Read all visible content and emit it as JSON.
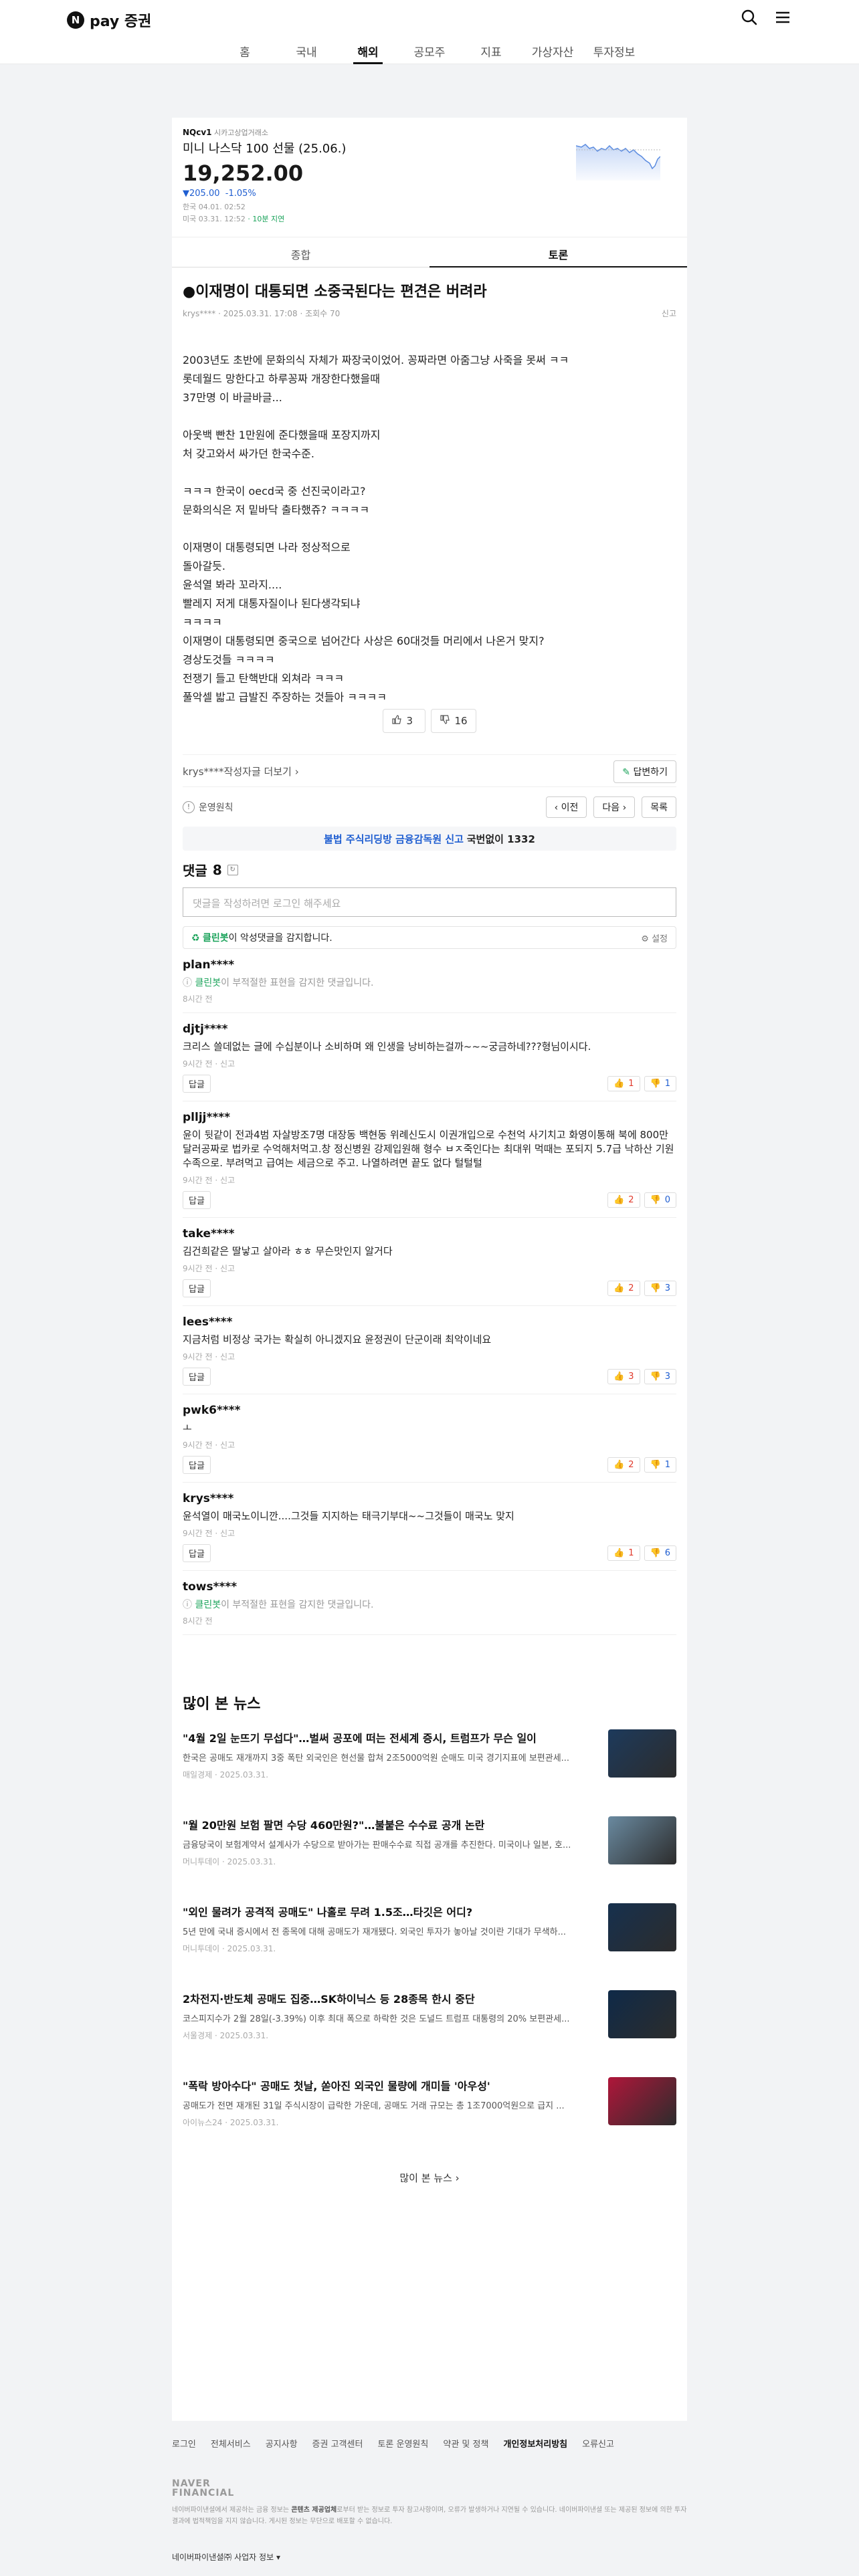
{
  "header": {
    "logo_n": "N",
    "logo_text": "pay 증권",
    "nav": [
      "홈",
      "국내",
      "해외",
      "공모주",
      "지표",
      "가상자산",
      "투자정보"
    ],
    "active_nav": "해외"
  },
  "stock": {
    "tag": "NQcv1",
    "exchange": "시카고상업거래소",
    "name": "미니 나스닥 100 선물 (25.06.)",
    "price": "19,252.00",
    "change": "▼205.00",
    "change_pct": "-1.05%",
    "kr_time": "한국 04.01. 02:52",
    "local_time": "미국 03.31. 12:52",
    "delay": "· 10분 지연",
    "down_color": "#1f5ed1"
  },
  "tabs": [
    "종합",
    "토론"
  ],
  "active_tab": "토론",
  "post": {
    "title": "●이재명이 대통되면 소중국된다는 편견은 버려라",
    "author": "krys****",
    "date": "2025.03.31. 17:08",
    "views": "조회수 70",
    "report": "신고",
    "body": [
      "2003년도 초반에 문화의식 자체가 짜장국이었어. 꽁짜라면 아줌그냥 사죽을 못써 ㅋㅋ",
      "롯데월드 망한다고 하루꽁짜 개장한다했을때",
      "37만명 이 바글바글...",
      "",
      "아웃백 빤찬 1만원에 준다했을때 포장지까지",
      "처 갖고와서 싸가던 한국수준.",
      "",
      "ㅋㅋㅋ 한국이 oecd국 중 선진국이라고?",
      "문화의식은 저 밑바닥 출타했쥬? ㅋㅋㅋㅋ",
      "",
      "이재명이 대통령되면 나라 정상적으로",
      "돌아갈듯.",
      "윤석열 봐라 꼬라지....",
      "빨레지 저게 대통자질이나 된다생각되냐",
      "ㅋㅋㅋㅋ",
      "이재명이 대통령되면 중국으로 넘어간다 사상은 60대것들 머리에서 나온거 맞지?",
      "경상도것들 ㅋㅋㅋㅋ",
      "전쟁기 들고 탄핵반대 외쳐라 ㅋㅋㅋ",
      "풀악셀 밟고 급발진 주장하는 것들아 ㅋㅋㅋㅋ"
    ],
    "likes": "3",
    "dislikes": "16",
    "more_by_author": "krys****작성자글 더보기",
    "reply_btn": "답변하기",
    "policy": "운영원칙",
    "prev": "이전",
    "next": "다음",
    "list": "목록",
    "banner_pre": "불법 주식리딩방 금융감독원 신고",
    "banner_post": "국번없이 1332"
  },
  "comments": {
    "label": "댓글",
    "count": "8",
    "placeholder": "댓글을 작성하려면 로그인 해주세요",
    "cleanbot_name": "클린봇",
    "cleanbot_text": "이 악성댓글을 감지합니다.",
    "setting": "설정",
    "reply_label": "답글",
    "report_label": "신고",
    "filtered_text": "이 부적절한 표현을 감지한 댓글입니다.",
    "items": [
      {
        "user": "plan****",
        "text": "",
        "time": "8시간 전",
        "up": "",
        "down": "",
        "filtered": true
      },
      {
        "user": "djtj****",
        "text": "크리스 쓸데없는 글에 수십분이나 소비하며 왜 인생을 낭비하는걸까~~~궁금하네???형님이시다.",
        "time": "9시간 전",
        "up": "1",
        "down": "1",
        "filtered": false
      },
      {
        "user": "plljj****",
        "text": "윤이 뒷같이 전과4범 자살방조7명 대장동 백현동 위례신도시 이권개입으로 수천억 사기치고 화영이통해 북에 800만달러공짜로 법카로 수억해처먹고.창 정신병원 강제입원해 형수 ㅂㅈ죽인다는 최대위 먹때는 포되지 5.7급 낙하산 기원 수족으로. 부려먹고 급여는 세금으로 주고. 나열하려면 끝도 없다 털털털",
        "time": "9시간 전",
        "up": "2",
        "down": "0",
        "filtered": false
      },
      {
        "user": "take****",
        "text": "김건희같은 딸낳고 살아라 ㅎㅎ 무슨맛인지 알거다",
        "time": "9시간 전",
        "up": "2",
        "down": "3",
        "filtered": false
      },
      {
        "user": "lees****",
        "text": "지금처럼 비정상 국가는 확실히 아니겠지요 윤정권이 단군이래 최악이네요",
        "time": "9시간 전",
        "up": "3",
        "down": "3",
        "filtered": false
      },
      {
        "user": "pwk6****",
        "text": "ㅗ",
        "time": "9시간 전",
        "up": "2",
        "down": "1",
        "filtered": false
      },
      {
        "user": "krys****",
        "text": "윤석열이 매국노이니깐....그것들 지지하는 태극기부대~~그것들이 매국노 맞지",
        "time": "9시간 전",
        "up": "1",
        "down": "6",
        "filtered": false
      },
      {
        "user": "tows****",
        "text": "",
        "time": "8시간 전",
        "up": "",
        "down": "",
        "filtered": true
      }
    ]
  },
  "news": {
    "title": "많이 본 뉴스",
    "more": "많이 본 뉴스",
    "items": [
      {
        "head": "\"4월 2일 눈뜨기 무섭다\"…벌써 공포에 떠는 전세계 증시, 트럼프가 무슨 일이",
        "sum": "한국은 공매도 재개까지 3중 폭탄 외국인은 현선물 합쳐 2조5000억원 순매도 미국 경기지표에 보편관세...",
        "src": "매일경제 · 2025.03.31."
      },
      {
        "head": "\"월 20만원 보험 팔면 수당 460만원?\"…불붙은 수수료 공개 논란",
        "sum": "금융당국이 보험계약서 설계사가 수당으로 받아가는 판매수수료 직접 공개를 추진한다. 미국이나 일본, 호...",
        "src": "머니투데이 · 2025.03.31."
      },
      {
        "head": "\"외인 물려가 공격적 공매도\" 나홀로 무려 1.5조…타깃은 어디?",
        "sum": "5년 만에 국내 증시에서 전 종목에 대해 공매도가 재개됐다. 외국인 투자가 놓아날 것이란 기대가 무색하...",
        "src": "머니투데이 · 2025.03.31."
      },
      {
        "head": "2차전지·반도체 공매도 집중…SK하이닉스 등 28종목 한시 중단",
        "sum": "코스피지수가 2월 28일(-3.39%) 이후 최대 폭으로 하락한 것은 도널드 트럼프 대통령의 20% 보편관세...",
        "src": "서울경제 · 2025.03.31."
      },
      {
        "head": "\"폭락 방아수다\" 공매도 첫날, 쏟아진 외국인 물량에 개미들 '아우성'",
        "sum": "공매도가 전면 재개된 31일 주식시장이 급락한 가운데, 공매도 거래 규모는 총 1조7000억원으로 급지 ...",
        "src": "아이뉴스24 · 2025.03.31."
      }
    ],
    "thumb_colors": [
      "#1d3a5c",
      "#6a8aa0",
      "#16304e",
      "#0f2a48",
      "#b0163a"
    ]
  },
  "footer": {
    "links": [
      "로그인",
      "전체서비스",
      "공지사항",
      "증권 고객센터",
      "토론 운영원칙",
      "약관 및 정책",
      "개인정보처리방침",
      "오류신고"
    ],
    "brand1": "NAVER",
    "brand2": "FINANCIAL",
    "notice1": "네이버파이낸셜에서 제공하는 금융 정보는 ",
    "notice_bold": "콘텐츠 제공업체",
    "notice2": "로부터 받는 정보로 투자 참고사항이며, 오류가 발생하거나 지연될 수 있습니다. 네이버파이낸셜 또는 제공된 정보에 의한 투자결과에 법적책임을 지지 않습니다. 게시된 정보는 무단으로 배포할 수 없습니다.",
    "biz": "네이버파이낸셜㈜ 사업자 정보"
  }
}
